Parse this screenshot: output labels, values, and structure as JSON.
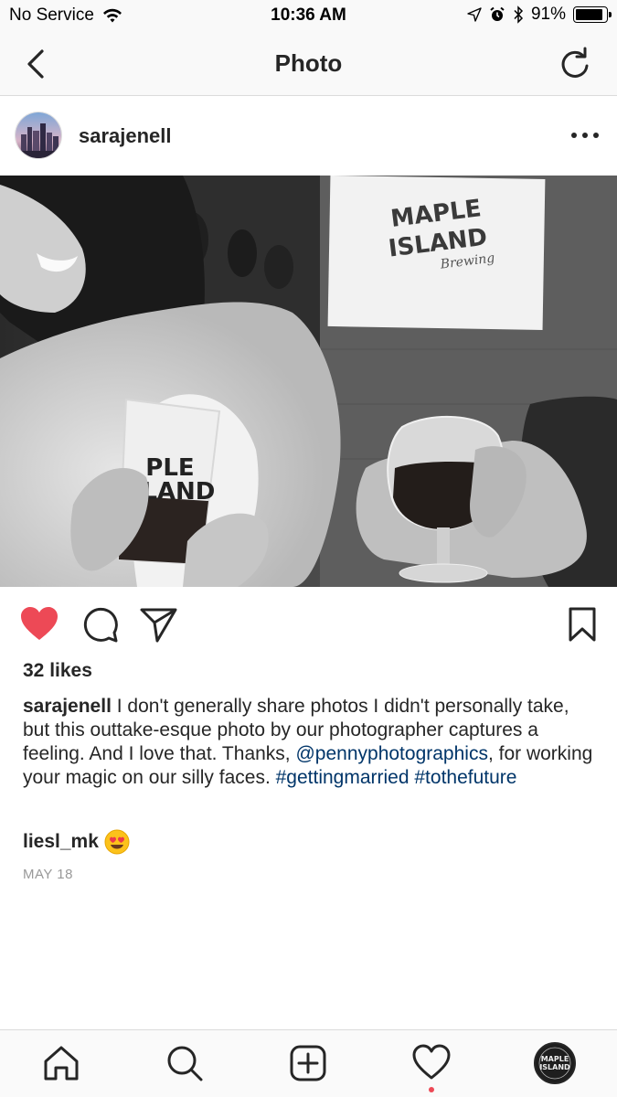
{
  "status_bar": {
    "carrier": "No Service",
    "time": "10:36 AM",
    "battery": "91%",
    "battery_level": 0.91
  },
  "nav": {
    "title": "Photo",
    "back_icon": "chevron-left-icon",
    "refresh_icon": "refresh-icon"
  },
  "post": {
    "username": "sarajenell",
    "likes": "32 likes",
    "caption": {
      "username": "sarajenell",
      "text_1": " I don't generally share photos I didn't personally take, but this outtake-esque photo by our photographer captures a feeling. And I love that. Thanks, ",
      "mention": "@pennyphotographics",
      "text_2": ", for working your magic on our silly faces. ",
      "hashtag_1": "#gettingmarried",
      "hashtag_2": "#tothefuture"
    },
    "comment": {
      "username": "liesl_mk",
      "emoji": "heart-eyes-emoji"
    },
    "date": "MAY 18",
    "photo_sign": {
      "line1": "MAPLE",
      "line2": "ISLAND",
      "line3": "Brewing"
    },
    "glass_print": {
      "line1": "PLE",
      "line2": "SLAND"
    }
  },
  "tab_bar": {
    "items": [
      "home-icon",
      "search-icon",
      "add-icon",
      "activity-heart-icon",
      "profile-avatar"
    ],
    "profile_logo": {
      "line1": "MAPLE",
      "line2": "ISLAND"
    }
  },
  "colors": {
    "like_red": "#ed4956",
    "link_blue": "#003569",
    "text": "#262626",
    "muted": "#999999"
  }
}
